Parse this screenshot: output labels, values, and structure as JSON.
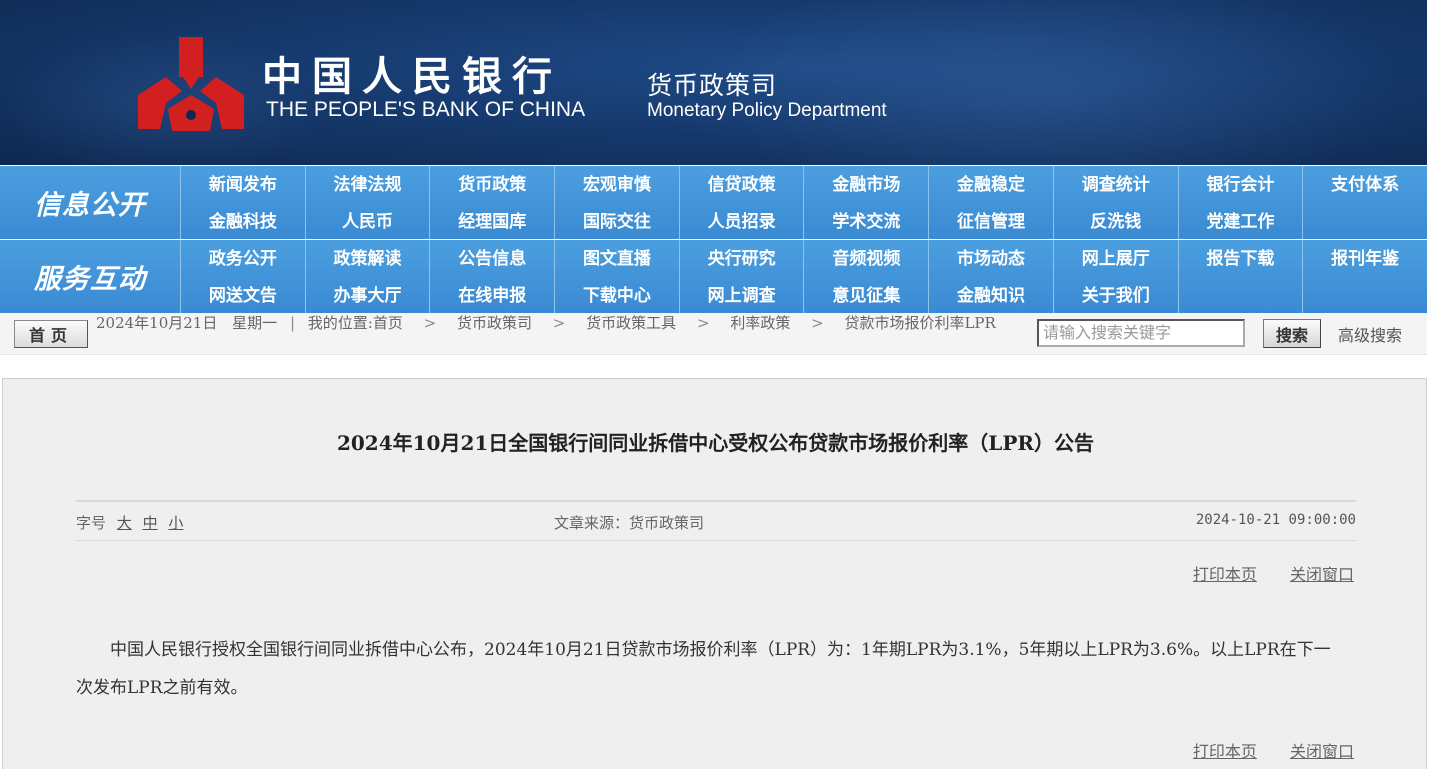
{
  "banner": {
    "cn_name": "中国人民银行",
    "en_name": "THE PEOPLE'S BANK OF CHINA",
    "dept_cn": "货币政策司",
    "dept_en": "Monetary Policy Department",
    "logo_color": "#d21f1f"
  },
  "nav_info": {
    "section_label": "信息公开",
    "row1": [
      "新闻发布",
      "法律法规",
      "货币政策",
      "宏观审慎",
      "信贷政策",
      "金融市场",
      "金融稳定",
      "调查统计",
      "银行会计",
      "支付体系"
    ],
    "row2": [
      "金融科技",
      "人民币",
      "经理国库",
      "国际交往",
      "人员招录",
      "学术交流",
      "征信管理",
      "反洗钱",
      "党建工作",
      ""
    ]
  },
  "nav_service": {
    "section_label": "服务互动",
    "row1": [
      "政务公开",
      "政策解读",
      "公告信息",
      "图文直播",
      "央行研究",
      "音频视频",
      "市场动态",
      "网上展厅",
      "报告下载",
      "报刊年鉴"
    ],
    "row2": [
      "网送文告",
      "办事大厅",
      "在线申报",
      "下载中心",
      "网上调查",
      "意见征集",
      "金融知识",
      "关于我们",
      "",
      ""
    ]
  },
  "location_bar": {
    "home_label": "首页",
    "date": "2024年10月21日",
    "weekday": "星期一",
    "location_prefix": "我的位置:",
    "crumbs": [
      "首页",
      "货币政策司",
      "货币政策工具",
      "利率政策",
      "贷款市场报价利率LPR"
    ],
    "search_placeholder": "请输入搜索关键字",
    "search_button": "搜索",
    "advanced_search": "高级搜索"
  },
  "article": {
    "title": "2024年10月21日全国银行间同业拆借中心受权公布贷款市场报价利率（LPR）公告",
    "font_size_label": "字号",
    "font_sizes": [
      "大",
      "中",
      "小"
    ],
    "source": "文章来源：货币政策司",
    "datetime": "2024-10-21 09:00:00",
    "print_label": "打印本页",
    "close_label": "关闭窗口",
    "body": "中国人民银行授权全国银行间同业拆借中心公布，2024年10月21日贷款市场报价利率（LPR）为：1年期LPR为3.1%，5年期以上LPR为3.6%。以上LPR在下一次发布LPR之前有效。"
  }
}
